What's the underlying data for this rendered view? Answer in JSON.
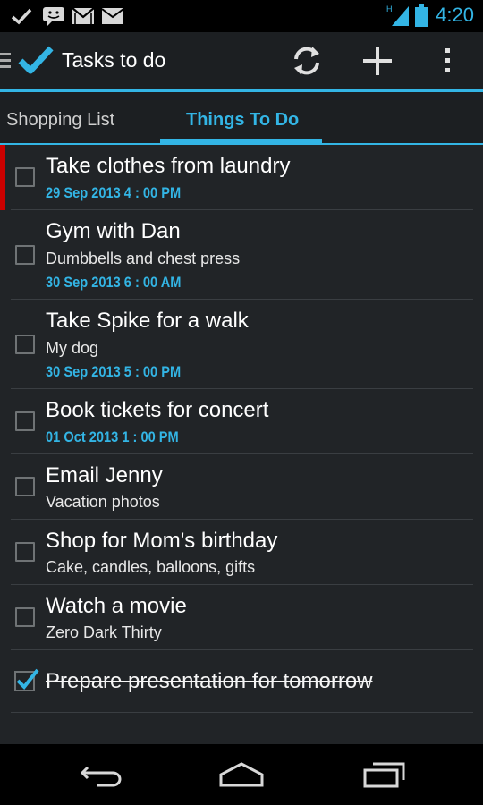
{
  "status_bar": {
    "time": "4:20",
    "network_type": "H",
    "icons": [
      "check-notification-icon",
      "chat-notification-icon",
      "gmail-notification-icon",
      "email-notification-icon",
      "signal-icon",
      "battery-icon"
    ]
  },
  "action_bar": {
    "title": "Tasks to do",
    "icons": [
      "drawer-icon",
      "app-logo-checkmark-icon",
      "sync-icon",
      "add-icon",
      "overflow-menu-icon"
    ]
  },
  "tabs": [
    {
      "label": "Shopping List",
      "selected": false
    },
    {
      "label": "Things To Do",
      "selected": true
    }
  ],
  "colors": {
    "accent": "#33b5e5",
    "priority_flag": "#cc0000",
    "background": "#212427"
  },
  "tasks": [
    {
      "title": "Take clothes from laundry",
      "subtitle": "",
      "due": "29 Sep 2013    4 : 00 PM",
      "done": false,
      "flagged": true
    },
    {
      "title": "Gym with Dan",
      "subtitle": "Dumbbells and chest press",
      "due": "30 Sep 2013    6 : 00 AM",
      "done": false,
      "flagged": false
    },
    {
      "title": "Take Spike for a walk",
      "subtitle": "My dog",
      "due": "30 Sep 2013    5 : 00 PM",
      "done": false,
      "flagged": false
    },
    {
      "title": "Book tickets for concert",
      "subtitle": "",
      "due": "01 Oct 2013    1 : 00 PM",
      "done": false,
      "flagged": false
    },
    {
      "title": "Email Jenny",
      "subtitle": "Vacation photos",
      "due": "",
      "done": false,
      "flagged": false
    },
    {
      "title": "Shop for Mom's birthday",
      "subtitle": "Cake, candles, balloons, gifts",
      "due": "",
      "done": false,
      "flagged": false
    },
    {
      "title": "Watch a movie",
      "subtitle": "Zero Dark Thirty",
      "due": "",
      "done": false,
      "flagged": false
    },
    {
      "title": "Prepare presentation for tomorrow",
      "subtitle": "",
      "due": "",
      "done": true,
      "flagged": false
    }
  ],
  "nav_bar": {
    "icons": [
      "back-icon",
      "home-icon",
      "recent-apps-icon"
    ]
  }
}
